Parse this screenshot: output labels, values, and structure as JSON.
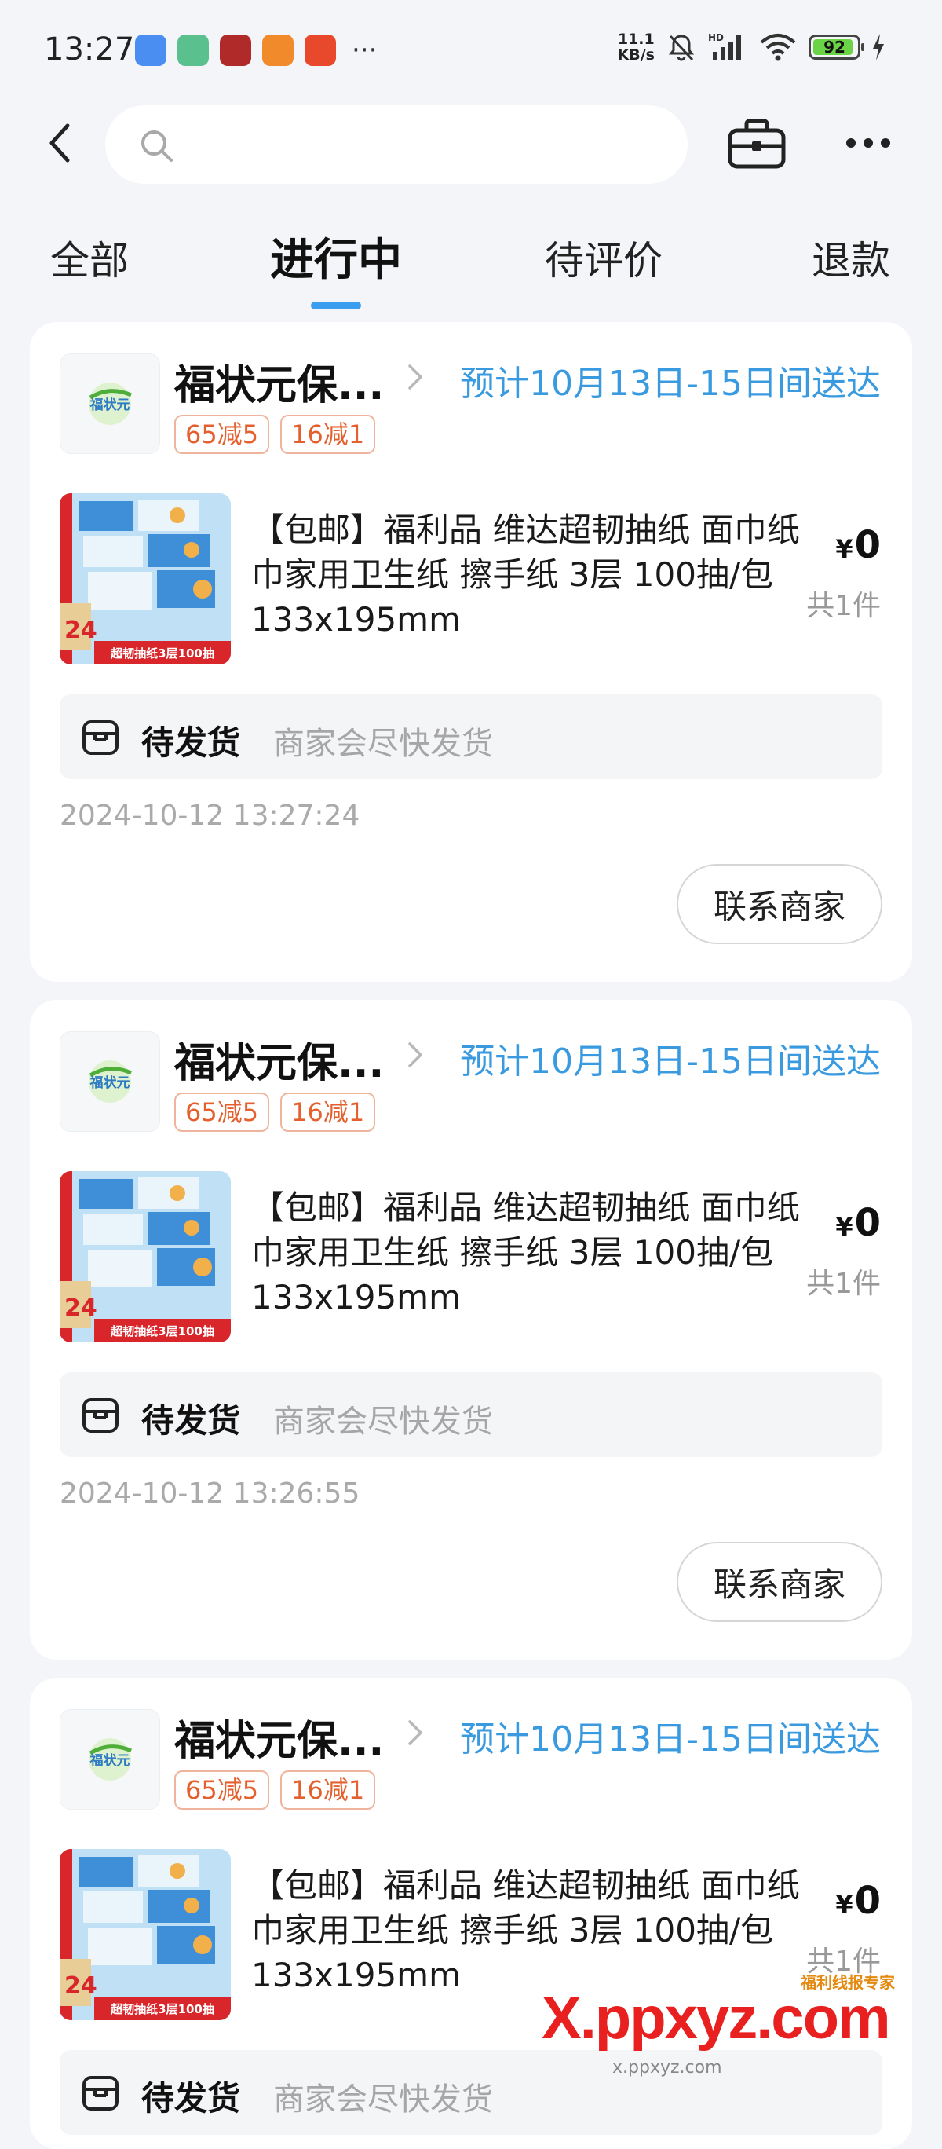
{
  "status_bar": {
    "time": "13:27",
    "net_speed_value": "11.1",
    "net_speed_unit": "KB/s",
    "signal_label": "HD",
    "battery": "92",
    "battery_level": 0.92,
    "app_icon_colors": [
      "#4a8ef2",
      "#5ac18e",
      "#b02a2a",
      "#f08a2b",
      "#e8492c"
    ]
  },
  "header": {
    "back_icon": "back-arrow-icon",
    "search_icon": "search-icon",
    "search_placeholder": "",
    "toolbox_icon": "toolbox-icon",
    "more_icon": "more-icon"
  },
  "tabs": [
    {
      "label": "全部",
      "active": false
    },
    {
      "label": "进行中",
      "active": true
    },
    {
      "label": "待评价",
      "active": false
    },
    {
      "label": "退款",
      "active": false
    }
  ],
  "orders": [
    {
      "shop_name": "福状元保...",
      "shop_logo_text": "福状元",
      "delivery": "预计10月13日-15日间送达",
      "coupons": [
        "65减5",
        "16减1"
      ],
      "product_title": "【包邮】福利品 维达超韧抽纸 面巾纸巾家用卫生纸 擦手纸 3层 100抽/包 133x195mm",
      "thumb_badge": "24",
      "thumb_caption": "超韧抽纸3层100抽",
      "currency": "¥",
      "price": "0",
      "quantity": "共1件",
      "status_title": "待发货",
      "status_desc": "商家会尽快发货",
      "timestamp": "2024-10-12 13:27:24",
      "contact_label": "联系商家"
    },
    {
      "shop_name": "福状元保...",
      "shop_logo_text": "福状元",
      "delivery": "预计10月13日-15日间送达",
      "coupons": [
        "65减5",
        "16减1"
      ],
      "product_title": "【包邮】福利品 维达超韧抽纸 面巾纸巾家用卫生纸 擦手纸 3层 100抽/包 133x195mm",
      "thumb_badge": "24",
      "thumb_caption": "超韧抽纸3层100抽",
      "currency": "¥",
      "price": "0",
      "quantity": "共1件",
      "status_title": "待发货",
      "status_desc": "商家会尽快发货",
      "timestamp": "2024-10-12 13:26:55",
      "contact_label": "联系商家"
    },
    {
      "shop_name": "福状元保...",
      "shop_logo_text": "福状元",
      "delivery": "预计10月13日-15日间送达",
      "coupons": [
        "65减5",
        "16减1"
      ],
      "product_title": "【包邮】福利品 维达超韧抽纸 面巾纸巾家用卫生纸 擦手纸 3层 100抽/包 133x195mm",
      "thumb_badge": "24",
      "thumb_caption": "超韧抽纸3层100抽",
      "currency": "¥",
      "price": "0",
      "quantity": "共1件",
      "status_title": "待发货",
      "status_desc": "商家会尽快发货"
    }
  ],
  "watermark": {
    "brand": "X.ppxyz.com",
    "tagline": "福利线报专家",
    "footer": "x.ppxyz.com"
  },
  "colors": {
    "accent_blue": "#3a9ae0",
    "coupon_orange": "#e4612f",
    "watermark_red": "#e8201f"
  }
}
